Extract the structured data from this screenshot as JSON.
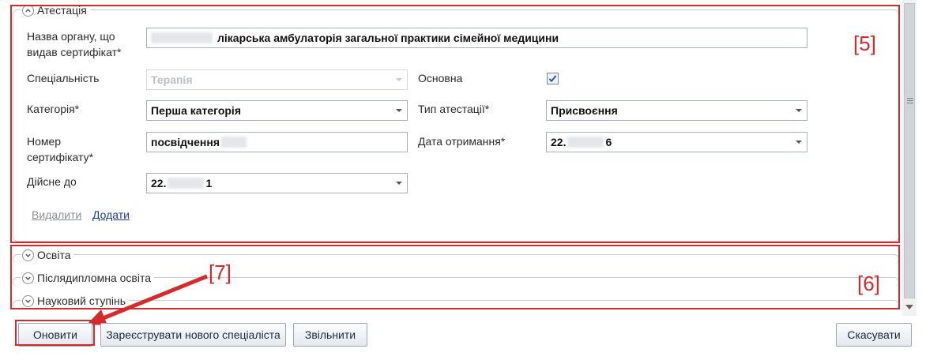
{
  "sections": {
    "attestation": {
      "title": "Атестація"
    },
    "education": {
      "title": "Освіта"
    },
    "postgraduate": {
      "title": "Післядипломна освіта"
    },
    "degree": {
      "title": "Науковий ступінь"
    }
  },
  "form": {
    "org_label": "Назва органу, що видав сертифікат*",
    "org_value": "лікарська амбулаторія загальної практики сімейної медицини",
    "specialty_label": "Спеціальність",
    "specialty_value": "Терапія",
    "main_label": "Основна",
    "main_checked": true,
    "category_label": "Категорія*",
    "category_value": "Перша категорія",
    "attestation_type_label": "Тип атестації*",
    "attestation_type_value": "Присвоєння",
    "cert_number_label": "Номер сертифікату*",
    "cert_number_value": "посвідчення",
    "received_date_label": "Дата отримання*",
    "received_date_prefix": "22.",
    "received_date_suffix": "6",
    "valid_until_label": "Дійсне до",
    "valid_until_prefix": "22.",
    "valid_until_suffix": "1",
    "delete_link": "Видалити",
    "add_link": "Додати"
  },
  "annotations": {
    "box5": "[5]",
    "box6": "[6]",
    "box7": "[7]"
  },
  "buttons": {
    "update": "Оновити",
    "register_new": "Зареєструвати нового спеціаліста",
    "dismiss": "Звільнити",
    "cancel": "Скасувати"
  },
  "colors": {
    "annotation_red": "#d62b2b",
    "link_blue": "#1a3f8f",
    "link_disabled": "#8a8f96"
  },
  "icons": {
    "collapse": "chevron-up-icon",
    "expand": "chevron-down-icon",
    "checkbox": "checkmark-icon"
  }
}
